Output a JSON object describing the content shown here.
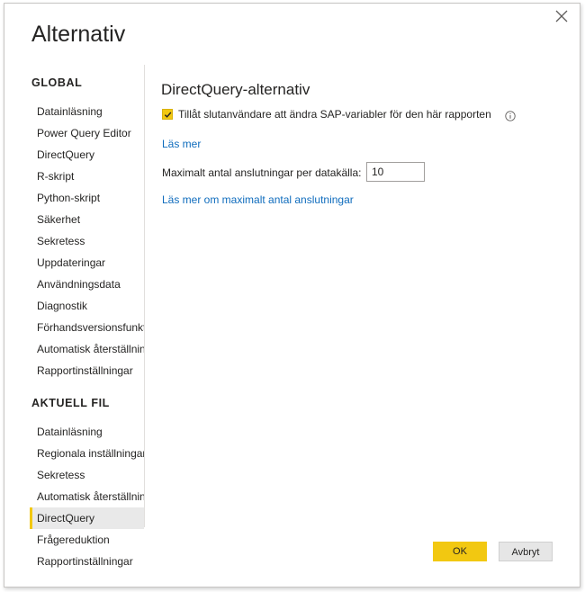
{
  "dialog": {
    "title": "Alternativ",
    "close_icon": "close-icon"
  },
  "sidebar": {
    "global_heading": "GLOBAL",
    "global_items": [
      {
        "label": "Datainläsning"
      },
      {
        "label": "Power Query Editor"
      },
      {
        "label": "DirectQuery"
      },
      {
        "label": "R-skript"
      },
      {
        "label": "Python-skript"
      },
      {
        "label": "Säkerhet"
      },
      {
        "label": "Sekretess"
      },
      {
        "label": "Uppdateringar"
      },
      {
        "label": "Användningsdata"
      },
      {
        "label": "Diagnostik"
      },
      {
        "label": "Förhandsversionsfunktioner"
      },
      {
        "label": "Automatisk återställning"
      },
      {
        "label": "Rapportinställningar"
      }
    ],
    "file_heading": "AKTUELL FIL",
    "file_items": [
      {
        "label": "Datainläsning"
      },
      {
        "label": "Regionala inställningar"
      },
      {
        "label": "Sekretess"
      },
      {
        "label": "Automatisk återställning"
      },
      {
        "label": "DirectQuery",
        "selected": true
      },
      {
        "label": "Frågereduktion"
      },
      {
        "label": "Rapportinställningar"
      }
    ]
  },
  "main": {
    "section_title": "DirectQuery-alternativ",
    "checkbox_label": "Tillåt slutanvändare att ändra SAP-variabler för den här rapporten",
    "checkbox_checked": true,
    "info_icon": "info-icon",
    "learn_more_link": "Läs mer",
    "max_connections_label": "Maximalt antal anslutningar per datakälla:",
    "max_connections_value": "10",
    "learn_more_connections_link": "Läs mer om maximalt antal anslutningar"
  },
  "footer": {
    "ok_label": "OK",
    "cancel_label": "Avbryt"
  },
  "colors": {
    "accent": "#f2c811",
    "link": "#0f6cbd",
    "selected_bg": "#e9e9e9"
  }
}
